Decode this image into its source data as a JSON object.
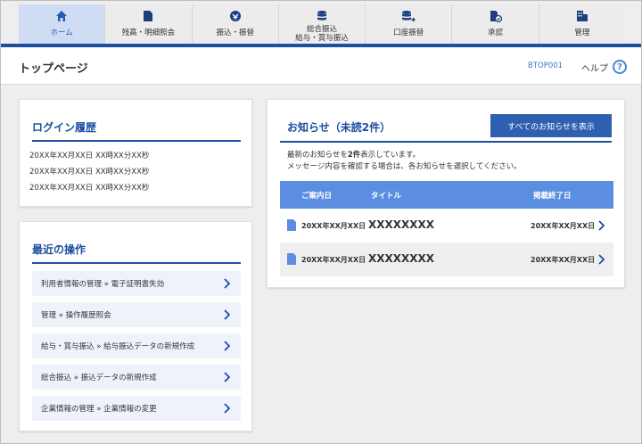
{
  "nav": {
    "items": [
      {
        "label": "ホーム",
        "icon": "home-icon"
      },
      {
        "label": "残高・明細照会",
        "icon": "document-icon"
      },
      {
        "label": "振込・振替",
        "icon": "transfer-icon"
      },
      {
        "label": "総合振込\n給与・賞与振込",
        "line1": "総合振込",
        "line2": "給与・賞与振込",
        "icon": "database-icon"
      },
      {
        "label": "口座振替",
        "icon": "account-transfer-icon"
      },
      {
        "label": "承認",
        "icon": "approval-icon"
      },
      {
        "label": "管理",
        "icon": "building-icon"
      }
    ],
    "active_color": "#1f5fb5"
  },
  "header": {
    "title": "トップページ",
    "page_code": "BTOP001",
    "help_label": "ヘルプ",
    "help_symbol": "?"
  },
  "login_history": {
    "title": "ログイン履歴",
    "entries": [
      "20XX年XX月XX日 XX時XX分XX秒",
      "20XX年XX月XX日 XX時XX分XX秒",
      "20XX年XX月XX日 XX時XX分XX秒"
    ]
  },
  "recent_ops": {
    "title": "最近の操作",
    "items": [
      "利用者情報の管理 » 電子証明書失効",
      "管理 » 操作履歴照会",
      "給与・賞与振込 » 給与振込データの新規作成",
      "総合振込 » 振込データの新規作成",
      "企業情報の管理 » 企業情報の変更"
    ]
  },
  "notices": {
    "title": "お知らせ（未読2件）",
    "view_all_label": "すべてのお知らせを表示",
    "message_line1_pre": "最新のお知らせを",
    "message_line1_bold": "2件",
    "message_line1_post": "表示しています。",
    "message_line2": "メッセージ内容を確認する場合は、各お知らせを選択してください。",
    "columns": {
      "date": "ご案内日",
      "title": "タイトル",
      "end": "掲載終了日"
    },
    "rows": [
      {
        "date": "20XX年XX月XX日",
        "title": "XXXXXXXX",
        "end": "20XX年XX月XX日"
      },
      {
        "date": "20XX年XX月XX日",
        "title": "XXXXXXXX",
        "end": "20XX年XX月XX日"
      }
    ]
  },
  "colors": {
    "brand": "#1d4fa0",
    "table_header": "#5b8ee0",
    "button": "#2f5fb0"
  }
}
